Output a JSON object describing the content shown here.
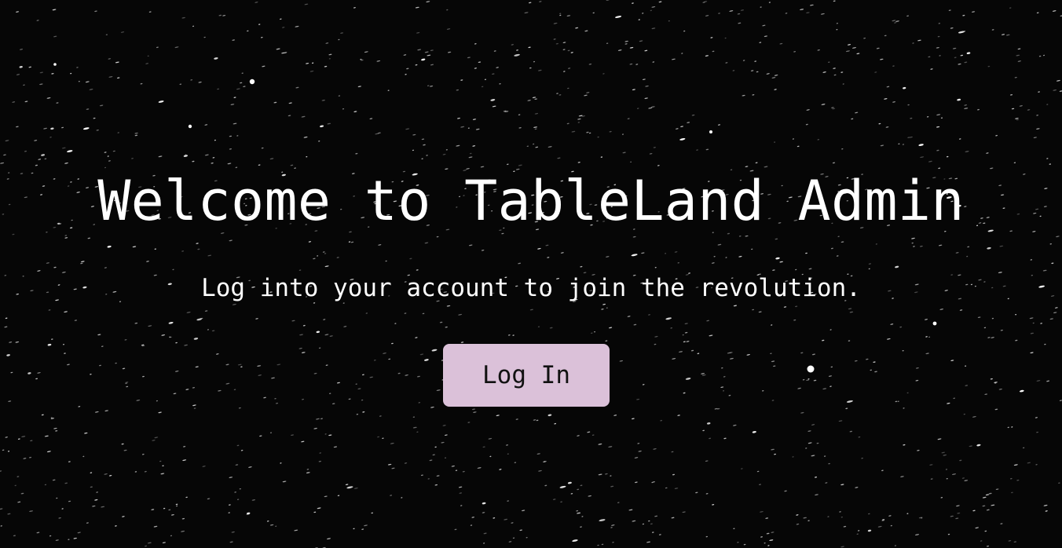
{
  "hero": {
    "title": "Welcome to TableLand Admin",
    "subtitle": "Log into your account to join the revolution.",
    "login_label": "Log In"
  },
  "colors": {
    "background": "#060606",
    "text": "#ffffff",
    "button_bg": "#dbc1d9",
    "button_text": "#111111"
  }
}
